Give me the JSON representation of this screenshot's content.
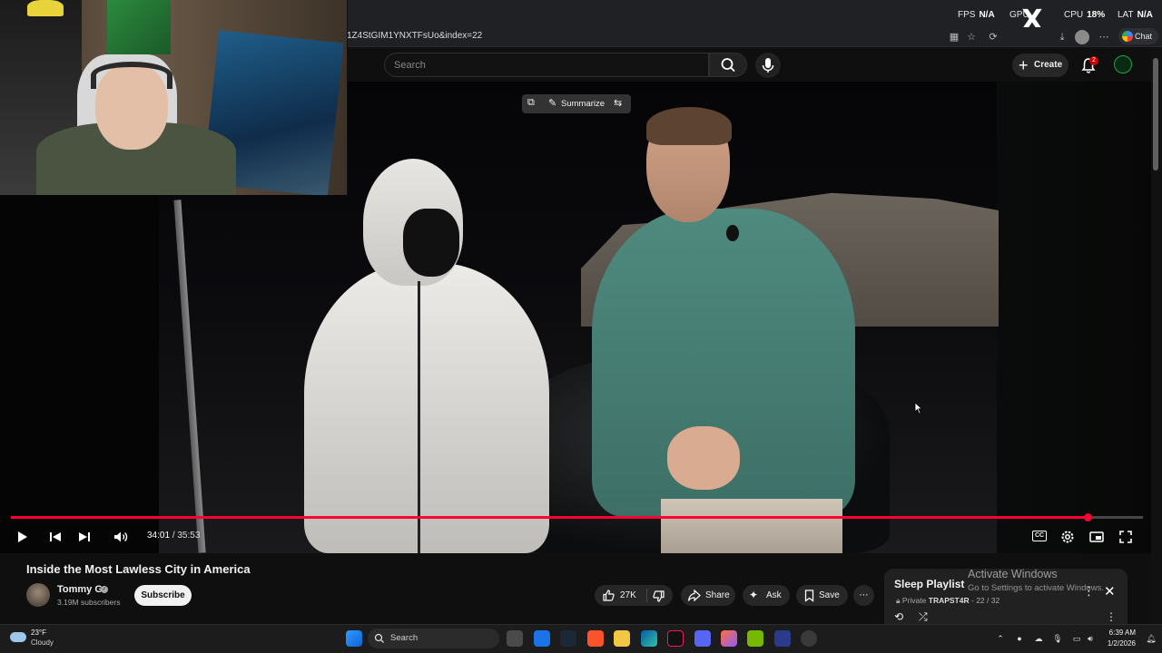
{
  "browser": {
    "url": "1Z4StGIM1YNXTFsUo&index=22",
    "chat_label": "Chat"
  },
  "overlay_stats": {
    "fps_label": "FPS",
    "fps_value": "N/A",
    "gpu_label": "GPU",
    "cpu_label": "CPU",
    "cpu_value": "18%",
    "lat_label": "LAT",
    "lat_value": "N/A",
    "x_logo": "X"
  },
  "youtube_header": {
    "search_placeholder": "Search",
    "create_label": "Create",
    "notification_count": "2"
  },
  "video": {
    "summarize_label": "Summarize",
    "progress_fraction": 0.951,
    "current_time": "34:01",
    "separator": "/",
    "duration": "35:53",
    "cc_label": "CC"
  },
  "details": {
    "title": "Inside the Most Lawless City in America",
    "channel_name": "Tommy G",
    "subscribers": "3.19M subscribers",
    "subscribe_label": "Subscribe",
    "likes": "27K",
    "share_label": "Share",
    "ask_label": "Ask",
    "save_label": "Save"
  },
  "playlist": {
    "title": "Sleep Playlist",
    "privacy": "Private",
    "owner": "TRAPST4R",
    "position": "22 / 32"
  },
  "watermark": {
    "line1": "Activate Windows",
    "line2": "Go to Settings to activate Windows."
  },
  "taskbar": {
    "temperature": "23°F",
    "weather": "Cloudy",
    "search_label": "Search",
    "time": "6:39 AM",
    "date": "1/2/2026"
  },
  "colors": {
    "accent_red": "#ff0033",
    "background": "#0f0f0f"
  }
}
